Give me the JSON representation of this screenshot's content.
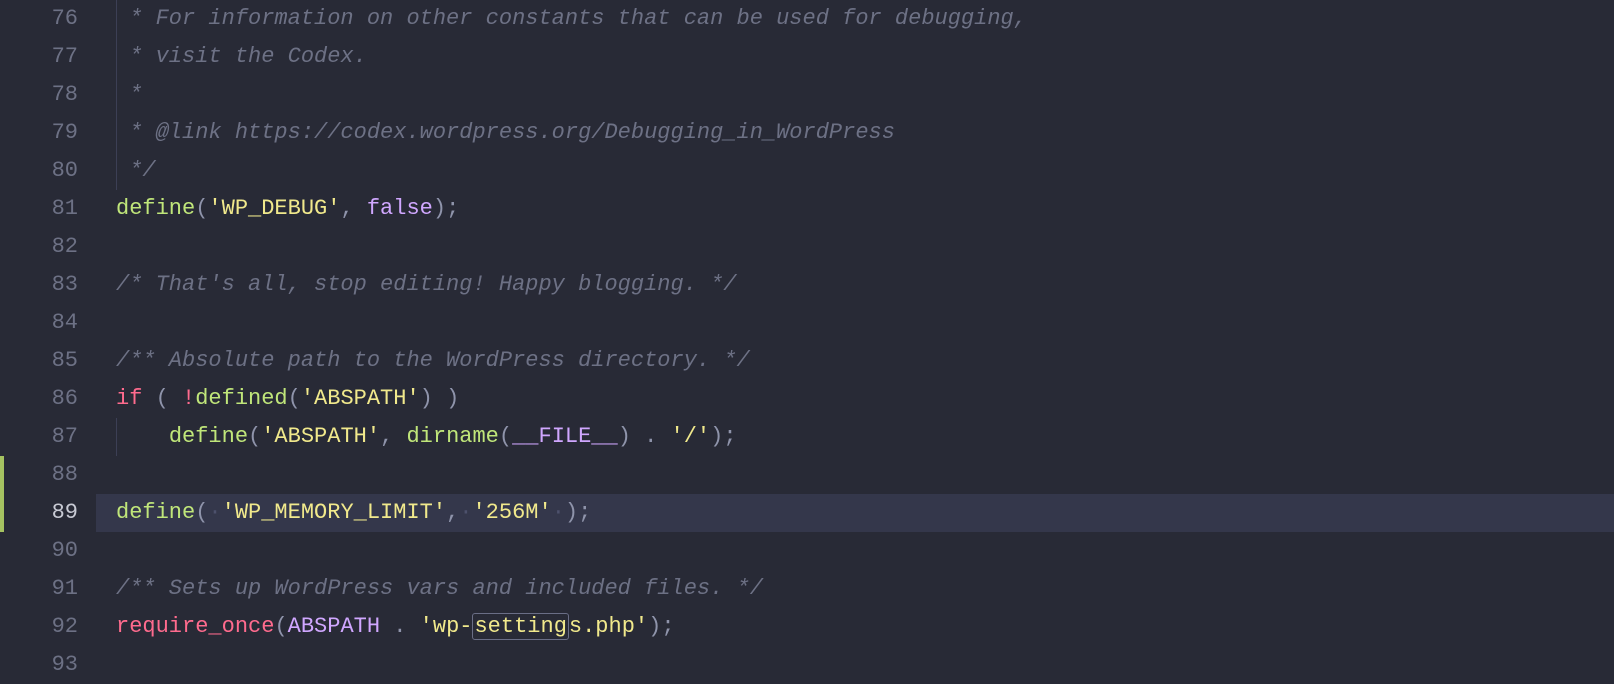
{
  "editor": {
    "first_line_number": 76,
    "highlighted_line_number": 89,
    "modified_line_numbers": [
      88,
      89
    ],
    "search_highlight": "setting",
    "lines": [
      {
        "n": 76,
        "indent": 1,
        "tokens": [
          {
            "t": " * For information on other constants that can be used for debugging,",
            "c": "comment"
          }
        ]
      },
      {
        "n": 77,
        "indent": 1,
        "tokens": [
          {
            "t": " * visit the Codex.",
            "c": "comment"
          }
        ]
      },
      {
        "n": 78,
        "indent": 1,
        "tokens": [
          {
            "t": " *",
            "c": "comment"
          }
        ]
      },
      {
        "n": 79,
        "indent": 1,
        "tokens": [
          {
            "t": " * @link https://codex.wordpress.org/Debugging_in_WordPress",
            "c": "comment"
          }
        ]
      },
      {
        "n": 80,
        "indent": 1,
        "tokens": [
          {
            "t": " */",
            "c": "comment"
          }
        ]
      },
      {
        "n": 81,
        "indent": 0,
        "tokens": [
          {
            "t": "define",
            "c": "fn"
          },
          {
            "t": "(",
            "c": "pn"
          },
          {
            "t": "'WP_DEBUG'",
            "c": "str"
          },
          {
            "t": ", ",
            "c": "pn"
          },
          {
            "t": "false",
            "c": "cst"
          },
          {
            "t": ")",
            "c": "pn"
          },
          {
            "t": ";",
            "c": "pn"
          }
        ]
      },
      {
        "n": 82,
        "indent": 0,
        "tokens": []
      },
      {
        "n": 83,
        "indent": 0,
        "tokens": [
          {
            "t": "/* That's all, stop editing! Happy blogging. */",
            "c": "comment"
          }
        ]
      },
      {
        "n": 84,
        "indent": 0,
        "tokens": []
      },
      {
        "n": 85,
        "indent": 0,
        "tokens": [
          {
            "t": "/** Absolute path to the WordPress directory. */",
            "c": "comment"
          }
        ]
      },
      {
        "n": 86,
        "indent": 0,
        "tokens": [
          {
            "t": "if",
            "c": "kw"
          },
          {
            "t": " ( ",
            "c": "pn"
          },
          {
            "t": "!",
            "c": "kw"
          },
          {
            "t": "defined",
            "c": "fn"
          },
          {
            "t": "(",
            "c": "pn"
          },
          {
            "t": "'ABSPATH'",
            "c": "str"
          },
          {
            "t": ") )",
            "c": "pn"
          }
        ]
      },
      {
        "n": 87,
        "indent": 1,
        "tokens": [
          {
            "t": "    ",
            "c": ""
          },
          {
            "t": "define",
            "c": "fn"
          },
          {
            "t": "(",
            "c": "pn"
          },
          {
            "t": "'ABSPATH'",
            "c": "str"
          },
          {
            "t": ", ",
            "c": "pn"
          },
          {
            "t": "dirname",
            "c": "fn"
          },
          {
            "t": "(",
            "c": "pn"
          },
          {
            "t": "__FILE__",
            "c": "cst"
          },
          {
            "t": ") ",
            "c": "pn"
          },
          {
            "t": ".",
            "c": "pn"
          },
          {
            "t": " ",
            "c": ""
          },
          {
            "t": "'/'",
            "c": "str"
          },
          {
            "t": ")",
            "c": "pn"
          },
          {
            "t": ";",
            "c": "pn"
          }
        ]
      },
      {
        "n": 88,
        "indent": 0,
        "tokens": []
      },
      {
        "n": 89,
        "indent": 0,
        "hl": true,
        "tokens": [
          {
            "t": "define",
            "c": "fn"
          },
          {
            "t": "(",
            "c": "pn"
          },
          {
            "t": "·",
            "c": "sp-dot"
          },
          {
            "t": "'WP_MEMORY_LIMIT'",
            "c": "str"
          },
          {
            "t": ",",
            "c": "pn"
          },
          {
            "t": "·",
            "c": "sp-dot"
          },
          {
            "t": "'256M'",
            "c": "str"
          },
          {
            "t": "·",
            "c": "sp-dot"
          },
          {
            "t": ")",
            "c": "pn"
          },
          {
            "t": ";",
            "c": "pn"
          }
        ]
      },
      {
        "n": 90,
        "indent": 0,
        "tokens": []
      },
      {
        "n": 91,
        "indent": 0,
        "tokens": [
          {
            "t": "/** Sets up WordPress vars and included files. */",
            "c": "comment"
          }
        ]
      },
      {
        "n": 92,
        "indent": 0,
        "tokens": [
          {
            "t": "require_once",
            "c": "kw"
          },
          {
            "t": "(",
            "c": "pn"
          },
          {
            "t": "ABSPATH",
            "c": "cst"
          },
          {
            "t": " ",
            "c": ""
          },
          {
            "t": ".",
            "c": "pn"
          },
          {
            "t": " ",
            "c": ""
          },
          {
            "t": "'wp-",
            "c": "str"
          },
          {
            "t": "setting",
            "c": "str",
            "box": true
          },
          {
            "t": "s.php'",
            "c": "str"
          },
          {
            "t": ")",
            "c": "pn"
          },
          {
            "t": ";",
            "c": "pn"
          }
        ]
      },
      {
        "n": 93,
        "indent": 0,
        "tokens": []
      }
    ]
  }
}
